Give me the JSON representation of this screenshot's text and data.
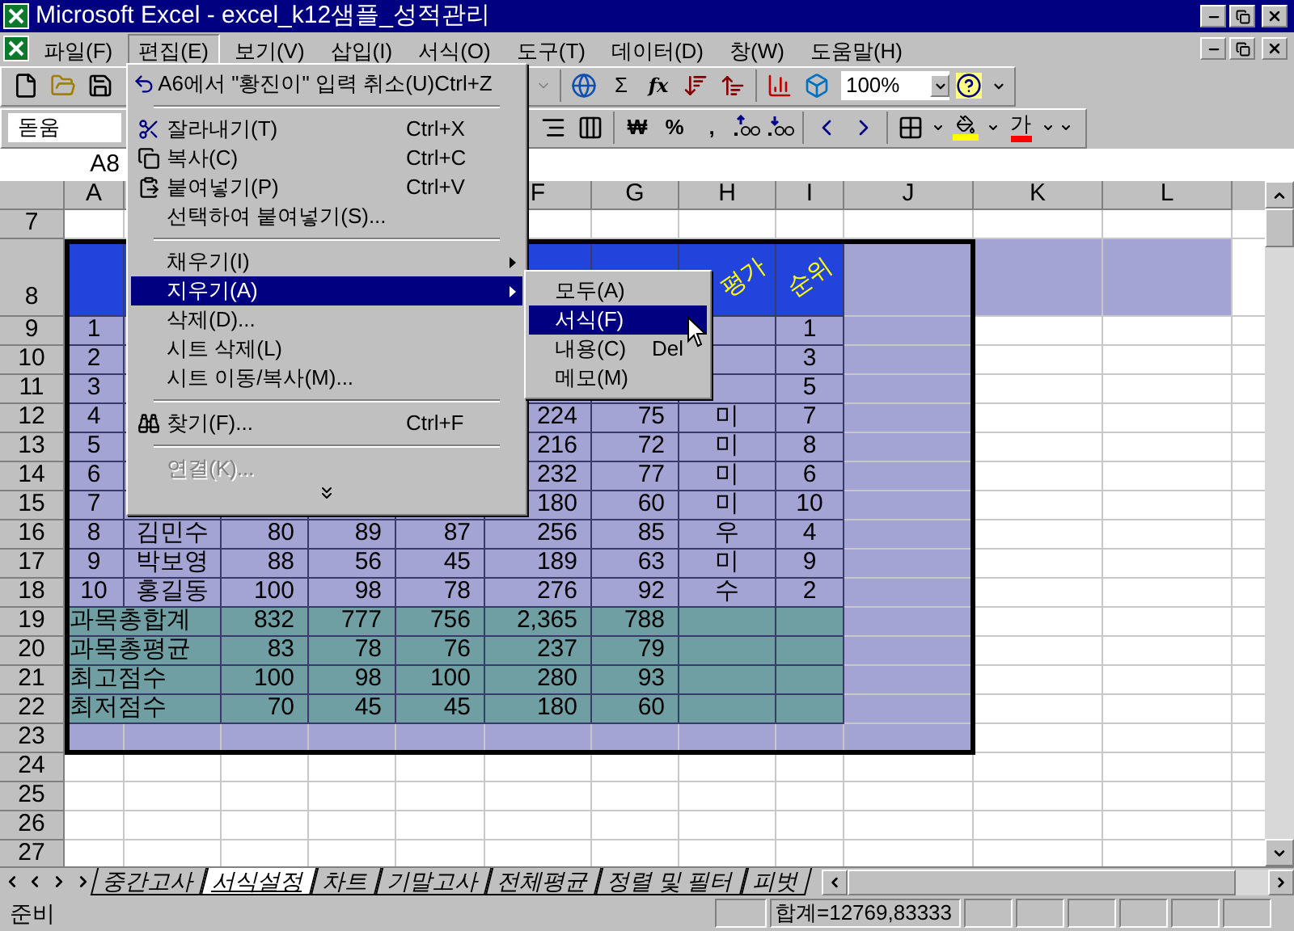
{
  "window": {
    "title": "Microsoft Excel - excel_k12샘플_성적관리"
  },
  "menu_bar": [
    {
      "label": "파일(F)",
      "selected": false
    },
    {
      "label": "편집(E)",
      "selected": true
    },
    {
      "label": "보기(V)",
      "selected": false
    },
    {
      "label": "삽입(I)",
      "selected": false
    },
    {
      "label": "서식(O)",
      "selected": false
    },
    {
      "label": "도구(T)",
      "selected": false
    },
    {
      "label": "데이터(D)",
      "selected": false
    },
    {
      "label": "창(W)",
      "selected": false
    },
    {
      "label": "도움말(H)",
      "selected": false
    }
  ],
  "standard_toolbar": {
    "sum": "Σ",
    "function": "fx",
    "zoom": "100%"
  },
  "formatting_toolbar": {
    "font": "돋움",
    "currency": "₩",
    "percent": "%",
    "comma": ",",
    "font_color": "가"
  },
  "formula_bar": {
    "name_box": "A8"
  },
  "columns": [
    "A",
    null,
    null,
    null,
    null,
    "F",
    "G",
    "H",
    "I",
    "J",
    "K",
    "L"
  ],
  "rows": [
    {
      "number": "7",
      "kind": "empty"
    },
    {
      "number": "8",
      "kind": "header",
      "cells": [
        null,
        null,
        null,
        null,
        null,
        null,
        null,
        "평가",
        "순위"
      ]
    },
    {
      "number": "9",
      "kind": "data",
      "cells": [
        "1",
        null,
        null,
        null,
        null,
        null,
        null,
        null,
        "1"
      ]
    },
    {
      "number": "10",
      "kind": "data",
      "cells": [
        "2",
        null,
        null,
        null,
        null,
        null,
        null,
        null,
        "3"
      ]
    },
    {
      "number": "11",
      "kind": "data",
      "cells": [
        "3",
        null,
        null,
        null,
        null,
        null,
        null,
        null,
        "5"
      ]
    },
    {
      "number": "12",
      "kind": "data",
      "cells": [
        "4",
        null,
        null,
        null,
        null,
        "224",
        "75",
        "미",
        "7"
      ]
    },
    {
      "number": "13",
      "kind": "data",
      "cells": [
        "5",
        null,
        null,
        null,
        null,
        "216",
        "72",
        "미",
        "8"
      ]
    },
    {
      "number": "14",
      "kind": "data",
      "cells": [
        "6",
        null,
        null,
        null,
        null,
        "232",
        "77",
        "미",
        "6"
      ]
    },
    {
      "number": "15",
      "kind": "data",
      "cells": [
        "7",
        null,
        null,
        null,
        null,
        "180",
        "60",
        "미",
        "10"
      ]
    },
    {
      "number": "16",
      "kind": "data",
      "cells": [
        "8",
        "김민수",
        "80",
        "89",
        "87",
        "256",
        "85",
        "우",
        "4"
      ]
    },
    {
      "number": "17",
      "kind": "data",
      "cells": [
        "9",
        "박보영",
        "88",
        "56",
        "45",
        "189",
        "63",
        "미",
        "9"
      ]
    },
    {
      "number": "18",
      "kind": "data",
      "cells": [
        "10",
        "홍길동",
        "100",
        "98",
        "78",
        "276",
        "92",
        "수",
        "2"
      ]
    },
    {
      "number": "19",
      "kind": "summary",
      "cells": [
        "과목총합계",
        null,
        "832",
        "777",
        "756",
        "2,365",
        "788",
        null,
        null
      ]
    },
    {
      "number": "20",
      "kind": "summary",
      "cells": [
        "과목총평균",
        null,
        "83",
        "78",
        "76",
        "237",
        "79",
        null,
        null
      ]
    },
    {
      "number": "21",
      "kind": "summary",
      "cells": [
        "최고점수",
        null,
        "100",
        "98",
        "100",
        "280",
        "93",
        null,
        null
      ]
    },
    {
      "number": "22",
      "kind": "summary",
      "cells": [
        "최저점수",
        null,
        "70",
        "45",
        "45",
        "180",
        "60",
        null,
        null
      ]
    },
    {
      "number": "23",
      "kind": "blank"
    },
    {
      "number": "24",
      "kind": "empty"
    },
    {
      "number": "25",
      "kind": "empty"
    },
    {
      "number": "26",
      "kind": "empty"
    },
    {
      "number": "27",
      "kind": "empty"
    }
  ],
  "edit_menu": [
    {
      "kind": "item",
      "label": "A6에서 \"황진이\" 입력 취소(U)",
      "shortcut": "Ctrl+Z",
      "submenu": false,
      "selected": false,
      "disabled": false
    },
    {
      "kind": "separator"
    },
    {
      "kind": "item",
      "label": "잘라내기(T)",
      "shortcut": "Ctrl+X",
      "submenu": false,
      "selected": false,
      "disabled": false
    },
    {
      "kind": "item",
      "label": "복사(C)",
      "shortcut": "Ctrl+C",
      "submenu": false,
      "selected": false,
      "disabled": false
    },
    {
      "kind": "item",
      "label": "붙여넣기(P)",
      "shortcut": "Ctrl+V",
      "submenu": false,
      "selected": false,
      "disabled": false
    },
    {
      "kind": "item",
      "label": "선택하여 붙여넣기(S)...",
      "submenu": false,
      "selected": false,
      "disabled": false
    },
    {
      "kind": "separator"
    },
    {
      "kind": "item",
      "label": "채우기(I)",
      "submenu": true,
      "selected": false,
      "disabled": false
    },
    {
      "kind": "item",
      "label": "지우기(A)",
      "submenu": true,
      "selected": true,
      "disabled": false
    },
    {
      "kind": "item",
      "label": "삭제(D)...",
      "submenu": false,
      "selected": false,
      "disabled": false
    },
    {
      "kind": "item",
      "label": "시트 삭제(L)",
      "submenu": false,
      "selected": false,
      "disabled": false
    },
    {
      "kind": "item",
      "label": "시트 이동/복사(M)...",
      "submenu": false,
      "selected": false,
      "disabled": false
    },
    {
      "kind": "separator"
    },
    {
      "kind": "item",
      "label": "찾기(F)...",
      "shortcut": "Ctrl+F",
      "submenu": false,
      "selected": false,
      "disabled": false
    },
    {
      "kind": "separator"
    },
    {
      "kind": "item",
      "label": "연결(K)...",
      "submenu": false,
      "selected": false,
      "disabled": true
    },
    {
      "kind": "expand"
    }
  ],
  "clear_submenu": [
    {
      "label": "모두(A)",
      "selected": false
    },
    {
      "label": "서식(F)",
      "selected": true
    },
    {
      "label": "내용(C)",
      "shortcut": "Del",
      "selected": false
    },
    {
      "label": "메모(M)",
      "selected": false
    }
  ],
  "sheet_tabs": [
    {
      "label": "중간고사",
      "selected": false
    },
    {
      "label": "서식설정",
      "selected": true
    },
    {
      "label": "차트",
      "selected": false
    },
    {
      "label": "기말고사",
      "selected": false
    },
    {
      "label": "전체평균",
      "selected": false
    },
    {
      "label": "정렬 및 필터",
      "selected": false
    },
    {
      "label": "피벗",
      "selected": false
    }
  ],
  "status_bar": {
    "mode": "준비",
    "sum": "합계=12769,83333"
  }
}
